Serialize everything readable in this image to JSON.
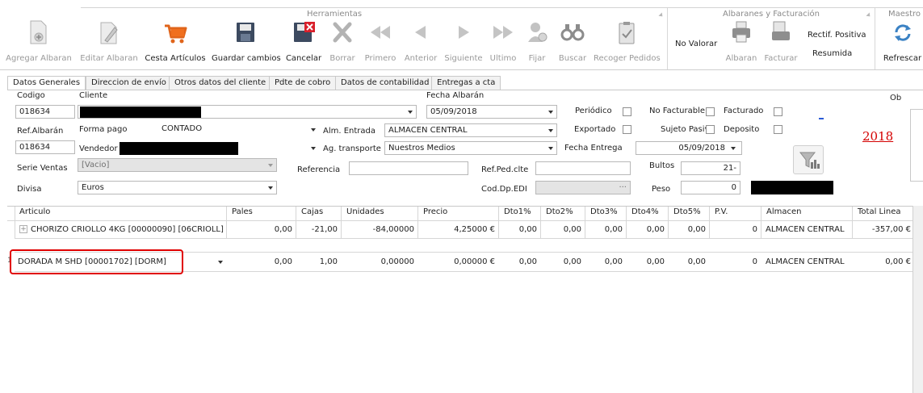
{
  "ribbon": {
    "groups": {
      "herramientas": "Herramientas",
      "albaranes": "Albaranes y Facturación",
      "maestros": "Maestro"
    },
    "buttons": {
      "agregar": "Agregar Albaran",
      "editar": "Editar Albaran",
      "cesta": "Cesta Artículos",
      "guardar": "Guardar cambios",
      "cancelar": "Cancelar",
      "borrar": "Borrar",
      "primero": "Primero",
      "anterior": "Anterior",
      "siguiente": "Siguiente",
      "ultimo": "Ultimo",
      "fijar": "Fijar",
      "buscar": "Buscar",
      "recoger": "Recoger Pedidos",
      "no_valorar": "No Valorar",
      "albaran": "Albaran",
      "facturar": "Facturar",
      "rectif": "Rectif. Positiva",
      "resumida": "Resumida",
      "refrescar": "Refrescar"
    }
  },
  "tabs": [
    "Datos Generales",
    "Direccion de envío",
    "Otros datos del cliente",
    "Pdte de cobro",
    "Datos de contabilidad",
    "Entregas a cta"
  ],
  "form": {
    "codigo_label": "Codigo",
    "codigo_value": "018634",
    "cliente_label": "Cliente",
    "fecha_albaran_label": "Fecha Albarán",
    "fecha_albaran_value": "05/09/2018",
    "periodico_label": "Periódico",
    "no_facturable_label": "No Facturable",
    "facturado_label": "Facturado",
    "ref_albaran_label": "Ref.Albarán",
    "ref_albaran_value": "018634",
    "forma_pago_label": "Forma pago",
    "forma_pago_value": "CONTADO",
    "alm_entrada_label": "Alm. Entrada",
    "alm_entrada_value": "ALMACEN CENTRAL",
    "exportado_label": "Exportado",
    "sujeto_pasivo_label": "Sujeto Pasivo",
    "deposito_label": "Deposito",
    "vendedor_label": "Vendedor",
    "ag_transporte_label": "Ag. transporte",
    "ag_transporte_value": "Nuestros Medios",
    "fecha_entrega_label": "Fecha Entrega",
    "fecha_entrega_value": "05/09/2018",
    "serie_label": "Serie Ventas",
    "serie_value": "[Vacio]",
    "referencia_label": "Referencia",
    "ref_ped_label": "Ref.Ped.clte",
    "bultos_label": "Bultos",
    "bultos_value": "21-",
    "divisa_label": "Divisa",
    "divisa_value": "Euros",
    "cod_dp_label": "Cod.Dp.EDI",
    "cod_dp_value": "···",
    "peso_label": "Peso",
    "peso_value": "0",
    "year": "2018",
    "ob_label": "Ob"
  },
  "grid": {
    "columns": [
      "Articulo",
      "Pales",
      "Cajas",
      "Unidades",
      "Precio",
      "Dto1%",
      "Dto2%",
      "Dto3%",
      "Dto4%",
      "Dto5%",
      "P.V.",
      "Almacen",
      "Total Linea"
    ],
    "rows": [
      {
        "articulo": "CHORIZO CRIOLLO 4KG [00000090] [06CRIOLL]",
        "pales": "0,00",
        "cajas": "-21,00",
        "unidades": "-84,00000",
        "precio": "4,25000 €",
        "dto1": "0,00",
        "dto2": "0,00",
        "dto3": "0,00",
        "dto4": "0,00",
        "dto5": "0,00",
        "pv": "0",
        "almacen": "ALMACEN CENTRAL",
        "total": "-357,00 €"
      },
      {
        "articulo": "DORADA M SHD [00001702] [DORM]",
        "pales": "0,00",
        "cajas": "1,00",
        "unidades": "0,00000",
        "precio": "0,00000 €",
        "dto1": "0,00",
        "dto2": "0,00",
        "dto3": "0,00",
        "dto4": "0,00",
        "dto5": "0,00",
        "pv": "0",
        "almacen": "ALMACEN CENTRAL",
        "total": "0,00 €"
      }
    ]
  }
}
